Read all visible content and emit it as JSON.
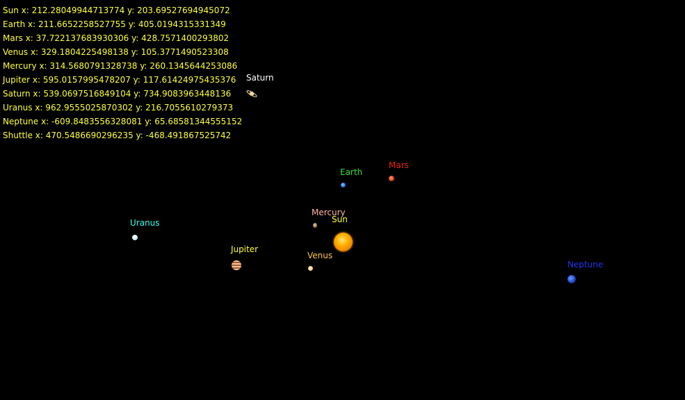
{
  "readouts": [
    {
      "text": "Sun x: 212.28049944713774 y: 203.69527694945072"
    },
    {
      "text": "Earth x: 211.6652258527755 y: 405.0194315331349"
    },
    {
      "text": "Mars x: 37.722137683930306 y: 428.7571400293802"
    },
    {
      "text": "Venus x: 329.1804225498138 y: 105.3771490523308"
    },
    {
      "text": "Mercury x: 314.5680791328738 y: 260.1345644253086"
    },
    {
      "text": "Jupiter x: 595.0157995478207 y: 117.61424975435376"
    },
    {
      "text": "Saturn x: 539.0697516849104 y: 734.9083963448136"
    },
    {
      "text": "Uranus x: 962.9555025870302 y: 216.7055610279373"
    },
    {
      "text": "Neptune x: -609.8483556328081 y: 65.68581344555152"
    },
    {
      "text": "Shuttle x: 470.5486690296235 y: -468.491867525742"
    }
  ],
  "readout_color": "#ffff33",
  "bodies": {
    "sun": {
      "label": "Sun",
      "color": "#ffff33",
      "icon": "sun-icon"
    },
    "earth": {
      "label": "Earth",
      "color": "#33dd33",
      "icon": "earth-icon"
    },
    "mars": {
      "label": "Mars",
      "color": "#ee2211",
      "icon": "mars-icon"
    },
    "mercury": {
      "label": "Mercury",
      "color": "#ffb6a6",
      "icon": "mercury-icon"
    },
    "venus": {
      "label": "Venus",
      "color": "#ffc83a",
      "icon": "venus-icon"
    },
    "jupiter": {
      "label": "Jupiter",
      "color": "#ffff33",
      "icon": "jupiter-icon"
    },
    "saturn": {
      "label": "Saturn",
      "color": "#ffffff",
      "icon": "saturn-icon"
    },
    "uranus": {
      "label": "Uranus",
      "color": "#33ffee",
      "icon": "uranus-icon"
    },
    "neptune": {
      "label": "Neptune",
      "color": "#2233ee",
      "icon": "neptune-icon"
    }
  },
  "background_color": "#000000"
}
